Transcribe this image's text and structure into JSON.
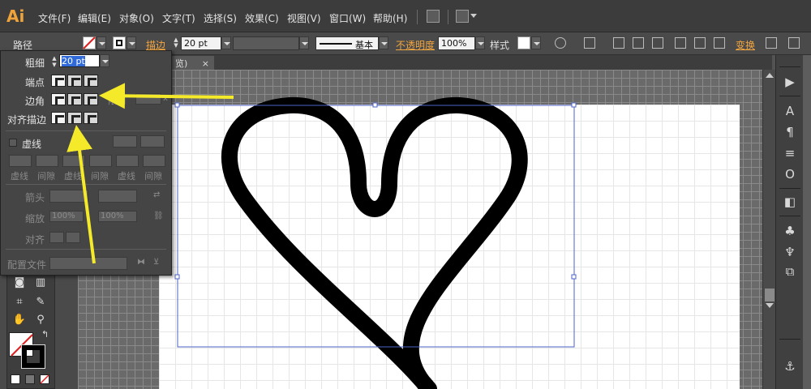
{
  "app": {
    "logo": "Ai"
  },
  "menu": [
    "文件(F)",
    "编辑(E)",
    "对象(O)",
    "文字(T)",
    "选择(S)",
    "效果(C)",
    "视图(V)",
    "窗口(W)",
    "帮助(H)"
  ],
  "controlbar": {
    "object_type": "路径",
    "stroke_label": "描边",
    "stroke_value": "20 pt",
    "brush_label": "基本",
    "opacity_label": "不透明度",
    "opacity_value": "100%",
    "style_label": "样式",
    "transform_label": "变换"
  },
  "document": {
    "tab_fragment": "览)",
    "tab_close": "×"
  },
  "stroke_panel": {
    "weight_label": "粗细",
    "weight_value": "20 pt",
    "cap_label": "端点",
    "corner_label": "边角",
    "limit_fragment": "限制",
    "limit_x": "x",
    "align_label": "对齐描边",
    "dashed_label": "虚线",
    "dash_labels": [
      "虚线",
      "间隙",
      "虚线",
      "间隙",
      "虚线",
      "间隙"
    ],
    "arrow_label": "箭头",
    "scale_label": "缩放",
    "scale_value_1": "100%",
    "scale_value_2": "100%",
    "align_arrow_label": "对齐",
    "profile_label": "配置文件"
  },
  "colors": {
    "accent_orange": "#f2a640",
    "annotation_yellow": "#f4ea2a",
    "selection_blue": "#4e63c7",
    "heart_stroke": "#000000"
  },
  "icons": [
    "arrow-tool-icon",
    "type-tool-icon",
    "paragraph-icon",
    "align-icon",
    "opentype-icon",
    "layers-icon",
    "symbols-icon",
    "brushes-icon",
    "export-icon"
  ]
}
